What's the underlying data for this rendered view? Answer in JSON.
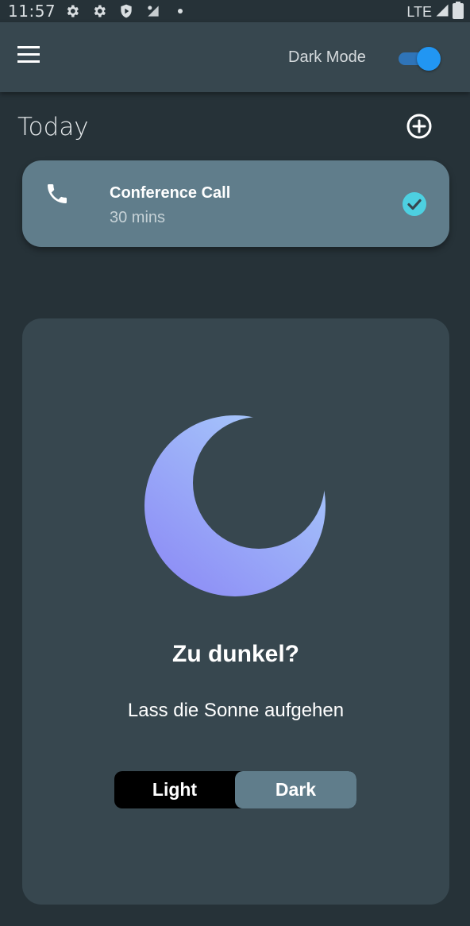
{
  "status_bar": {
    "time": "11:57",
    "network": "LTE",
    "icons": [
      "settings-icon",
      "settings-icon",
      "shield-play-icon",
      "signal-dot-icon",
      "dot-icon",
      "cell-signal-icon",
      "battery-icon"
    ]
  },
  "app_bar": {
    "menu_icon": "hamburger-menu-icon",
    "dark_mode_label": "Dark Mode",
    "dark_mode_on": true
  },
  "today": {
    "title": "Today",
    "add_icon": "add-circle-icon"
  },
  "task": {
    "icon": "phone-icon",
    "title": "Conference Call",
    "duration": "30 mins",
    "completed": true
  },
  "theme_panel": {
    "illustration": "moon-icon",
    "heading": "Zu dunkel?",
    "subheading": "Lass die Sonne aufgehen",
    "options": [
      "Light",
      "Dark"
    ],
    "selected": "Dark"
  },
  "colors": {
    "background": "#263238",
    "app_bar": "#37474f",
    "card": "#607d8b",
    "accent": "#2196f3",
    "check": "#4dd0e1"
  }
}
